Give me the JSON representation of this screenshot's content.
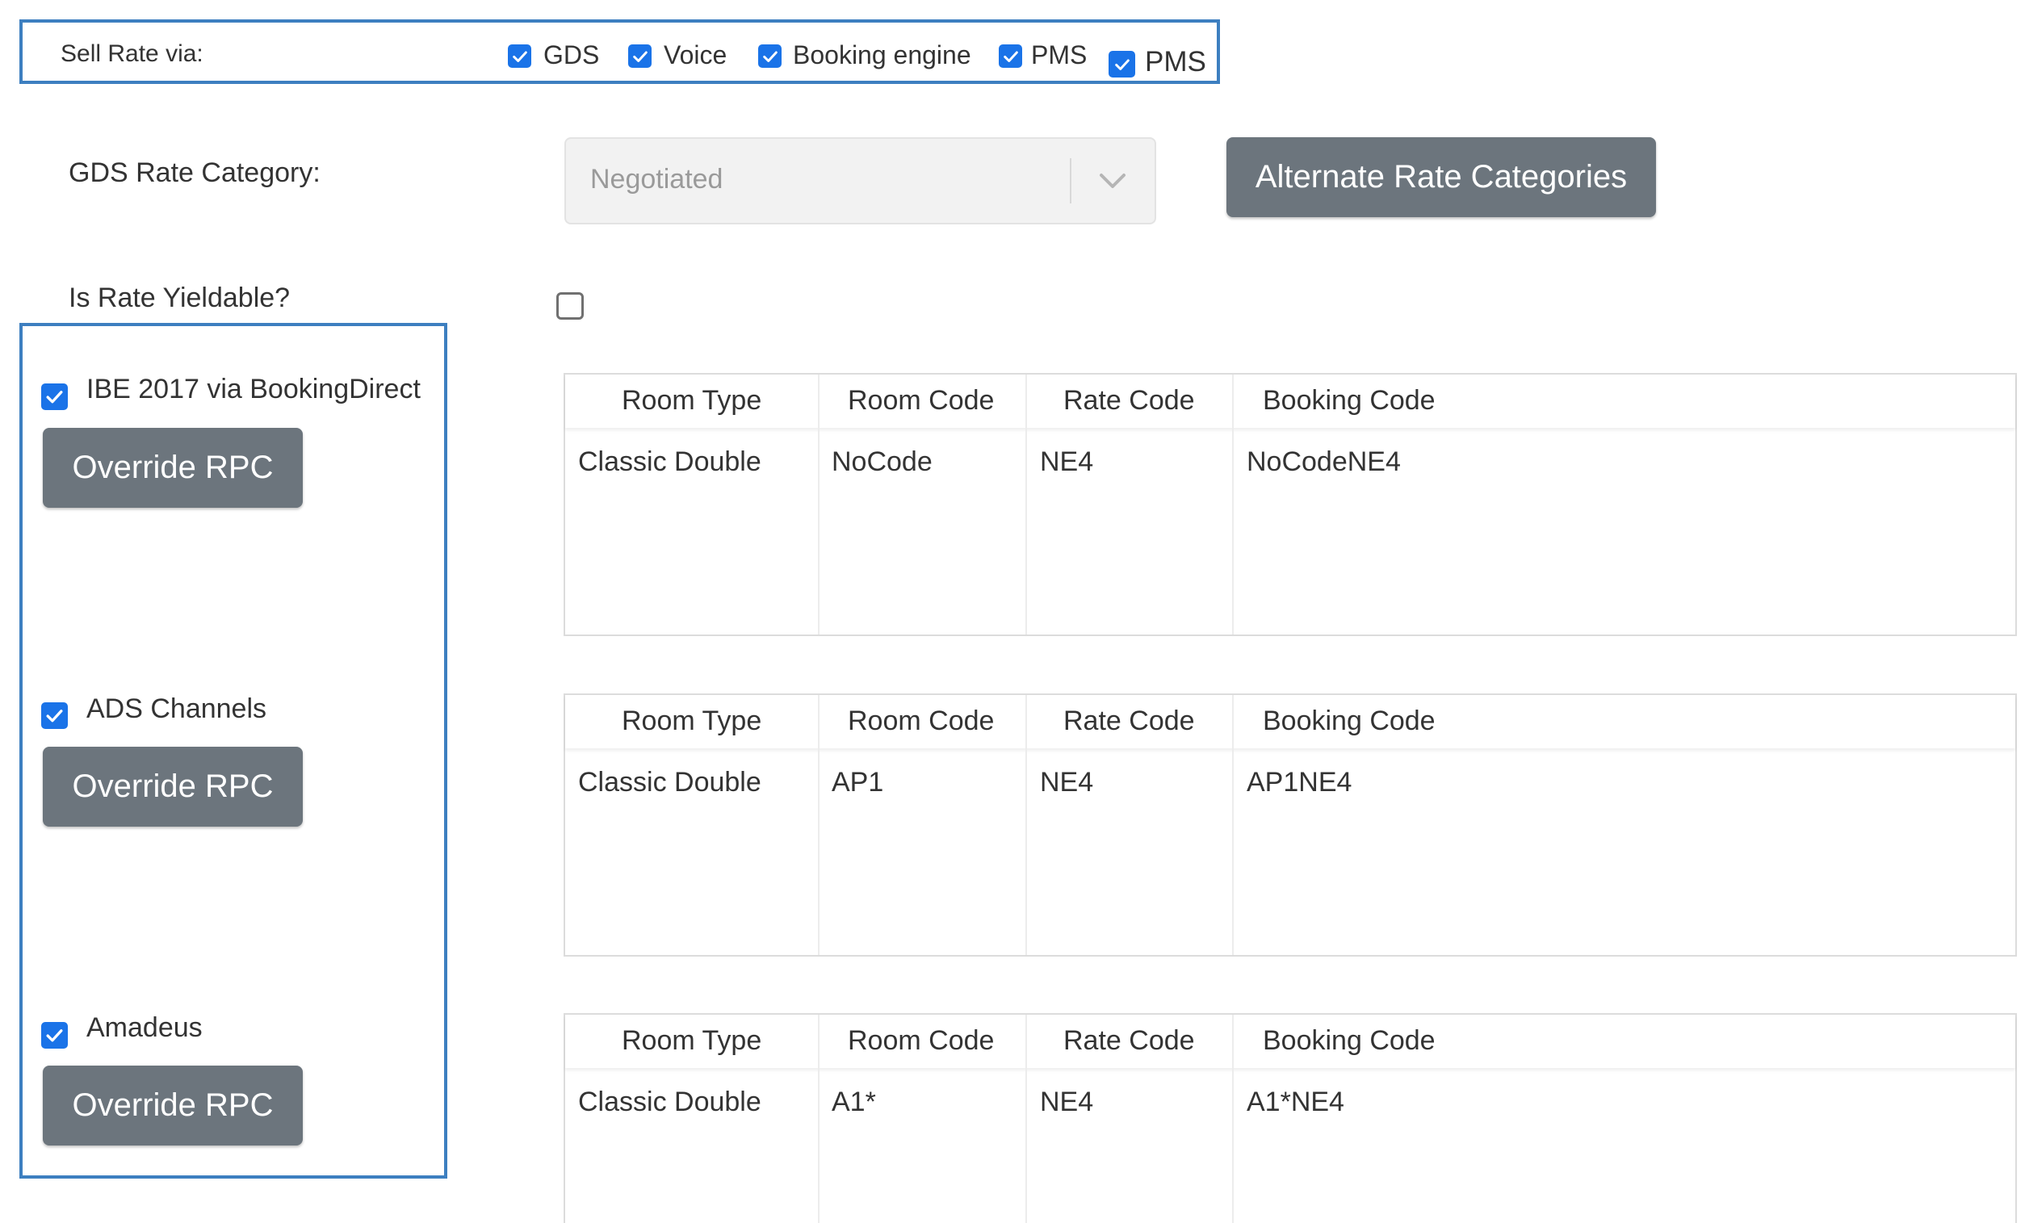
{
  "sell_rate": {
    "label": "Sell Rate via:",
    "options": [
      {
        "label": "GDS",
        "checked": true
      },
      {
        "label": "Voice",
        "checked": true
      },
      {
        "label": "Booking engine",
        "checked": true
      },
      {
        "label": "PMS",
        "checked": true
      },
      {
        "label": "PMS",
        "checked": true
      }
    ]
  },
  "gds_rate_category": {
    "label": "GDS Rate Category:",
    "selected": "Negotiated"
  },
  "alternate_button_label": "Alternate Rate Categories",
  "yieldable": {
    "label": "Is Rate Yieldable?",
    "checked": false
  },
  "channels": [
    {
      "label": "IBE 2017 via BookingDirect",
      "checked": true,
      "button": "Override RPC",
      "table": {
        "headers": [
          "Room Type",
          "Room Code",
          "Rate Code",
          "Booking Code"
        ],
        "rows": [
          [
            "Classic Double",
            "NoCode",
            "NE4",
            "NoCodeNE4"
          ]
        ]
      }
    },
    {
      "label": "ADS Channels",
      "checked": true,
      "button": "Override RPC",
      "table": {
        "headers": [
          "Room Type",
          "Room Code",
          "Rate Code",
          "Booking Code"
        ],
        "rows": [
          [
            "Classic Double",
            "AP1",
            "NE4",
            "AP1NE4"
          ]
        ]
      }
    },
    {
      "label": "Amadeus",
      "checked": true,
      "button": "Override RPC",
      "table": {
        "headers": [
          "Room Type",
          "Room Code",
          "Rate Code",
          "Booking Code"
        ],
        "rows": [
          [
            "Classic Double",
            "A1*",
            "NE4",
            "A1*NE4"
          ]
        ]
      }
    }
  ],
  "colors": {
    "checkbox": "#1a73e8",
    "button": "#6c757d",
    "highlight_border": "#3d7fc0"
  }
}
